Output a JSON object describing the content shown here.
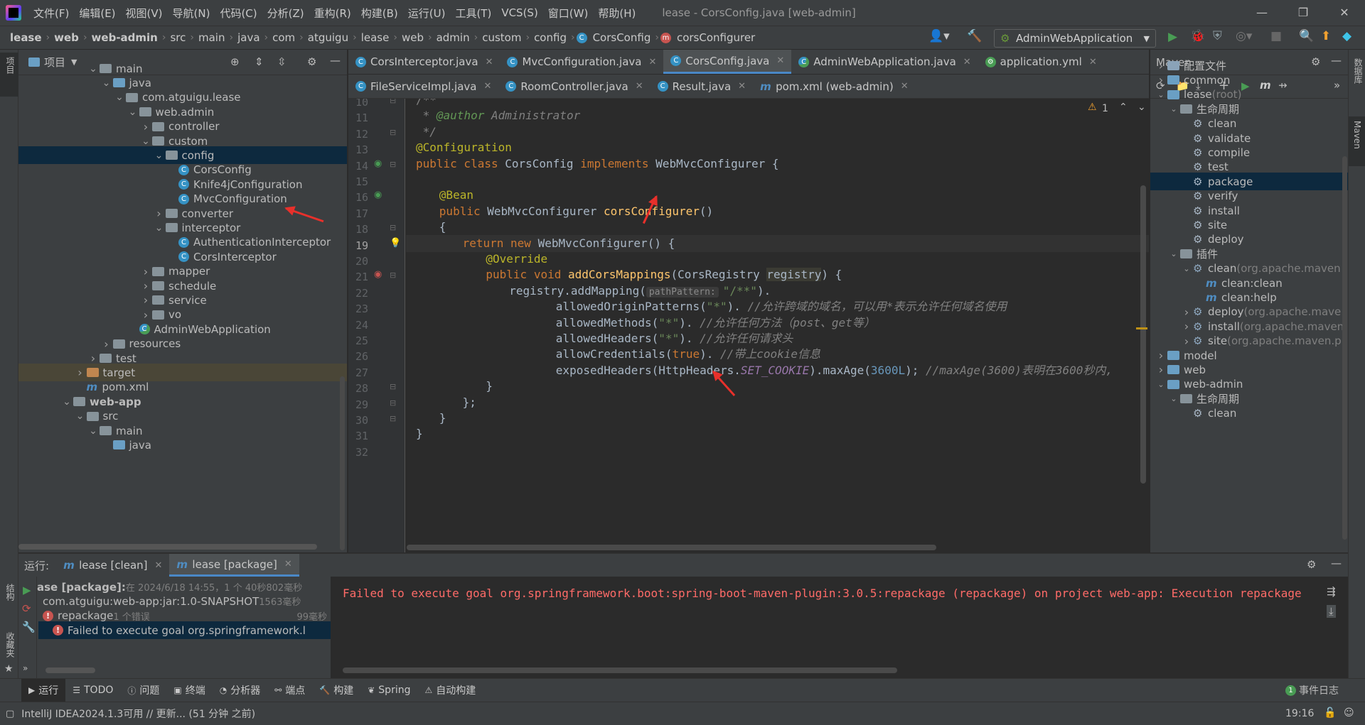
{
  "menubar": {
    "items": [
      "文件(F)",
      "编辑(E)",
      "视图(V)",
      "导航(N)",
      "代码(C)",
      "分析(Z)",
      "重构(R)",
      "构建(B)",
      "运行(U)",
      "工具(T)",
      "VCS(S)",
      "窗口(W)",
      "帮助(H)"
    ],
    "window_title": "lease - CorsConfig.java [web-admin]"
  },
  "breadcrumbs": [
    "lease",
    "web",
    "web-admin",
    "src",
    "main",
    "java",
    "com",
    "atguigu",
    "lease",
    "web",
    "admin",
    "custom",
    "config",
    "CorsConfig",
    "corsConfigurer"
  ],
  "run_config": "AdminWebApplication",
  "project_panel": {
    "title": "项目",
    "tree": [
      {
        "label": "main",
        "arrow": "v",
        "icon": "folder",
        "indent": 0
      },
      {
        "label": "java",
        "arrow": "v",
        "icon": "folder-blue",
        "indent": 1
      },
      {
        "label": "com.atguigu.lease",
        "arrow": "v",
        "icon": "folder",
        "indent": 2
      },
      {
        "label": "web.admin",
        "arrow": "v",
        "icon": "folder",
        "indent": 3
      },
      {
        "label": "controller",
        "arrow": ">",
        "icon": "folder",
        "indent": 4
      },
      {
        "label": "custom",
        "arrow": "v",
        "icon": "folder",
        "indent": 4
      },
      {
        "label": "config",
        "arrow": "v",
        "icon": "folder",
        "indent": 5,
        "selected": true
      },
      {
        "label": "CorsConfig",
        "arrow": "",
        "icon": "class",
        "indent": 6
      },
      {
        "label": "Knife4jConfiguration",
        "arrow": "",
        "icon": "class",
        "indent": 6
      },
      {
        "label": "MvcConfiguration",
        "arrow": "",
        "icon": "class",
        "indent": 6
      },
      {
        "label": "converter",
        "arrow": ">",
        "icon": "folder",
        "indent": 5
      },
      {
        "label": "interceptor",
        "arrow": "v",
        "icon": "folder",
        "indent": 5
      },
      {
        "label": "AuthenticationInterceptor",
        "arrow": "",
        "icon": "class",
        "indent": 6
      },
      {
        "label": "CorsInterceptor",
        "arrow": "",
        "icon": "class",
        "indent": 6
      },
      {
        "label": "mapper",
        "arrow": ">",
        "icon": "folder",
        "indent": 4
      },
      {
        "label": "schedule",
        "arrow": ">",
        "icon": "folder",
        "indent": 4
      },
      {
        "label": "service",
        "arrow": ">",
        "icon": "folder",
        "indent": 4
      },
      {
        "label": "vo",
        "arrow": ">",
        "icon": "folder",
        "indent": 4
      },
      {
        "label": "AdminWebApplication",
        "arrow": "",
        "icon": "springclass",
        "indent": 3
      },
      {
        "label": "resources",
        "arrow": ">",
        "icon": "folder",
        "indent": 1
      },
      {
        "label": "test",
        "arrow": ">",
        "icon": "folder",
        "indent": 0
      },
      {
        "label": "target",
        "arrow": ">",
        "icon": "folder-orange",
        "indent": -1,
        "excluded": true
      },
      {
        "label": "pom.xml",
        "arrow": "",
        "icon": "maven",
        "indent": -1
      },
      {
        "label": "web-app",
        "arrow": "v",
        "icon": "folder",
        "indent": -2,
        "bold": true
      },
      {
        "label": "src",
        "arrow": "v",
        "icon": "folder",
        "indent": -1
      },
      {
        "label": "main",
        "arrow": "v",
        "icon": "folder",
        "indent": 0
      },
      {
        "label": "java",
        "arrow": "",
        "icon": "folder-blue",
        "indent": 1
      }
    ]
  },
  "editor_tabs_row1": [
    {
      "label": "CorsInterceptor.java",
      "icon": "class"
    },
    {
      "label": "MvcConfiguration.java",
      "icon": "class"
    },
    {
      "label": "CorsConfig.java",
      "icon": "class",
      "active": true
    },
    {
      "label": "AdminWebApplication.java",
      "icon": "springclass"
    },
    {
      "label": "application.yml",
      "icon": "yml"
    }
  ],
  "editor_tabs_row2": [
    {
      "label": "FileServiceImpl.java",
      "icon": "class"
    },
    {
      "label": "RoomController.java",
      "icon": "class"
    },
    {
      "label": "Result.java",
      "icon": "class"
    },
    {
      "label": "pom.xml (web-admin)",
      "icon": "maven"
    }
  ],
  "editor": {
    "warning_count": "1",
    "line_numbers": [
      "10",
      "11",
      "12",
      "13",
      "14",
      "15",
      "16",
      "17",
      "18",
      "19",
      "20",
      "21",
      "22",
      "23",
      "24",
      "25",
      "26",
      "27",
      "28",
      "29",
      "30",
      "31",
      "32"
    ],
    "current_line": "19",
    "param_hint": "pathPattern:",
    "code": {
      "l10": "/**",
      "l11a": " * ",
      "l11b": "@author",
      "l11c": " Administrator",
      "l12": " */",
      "l13": "@Configuration",
      "l14a": "public class ",
      "l14b": "CorsConfig ",
      "l14c": "implements ",
      "l14d": "WebMvcConfigurer {",
      "l16": "@Bean",
      "l17a": "public ",
      "l17b": "WebMvcConfigurer ",
      "l17c": "corsConfigurer",
      "l17d": "()",
      "l18": "{",
      "l19a": "return ",
      "l19b": "new ",
      "l19c": "WebMvcConfigurer() {",
      "l20": "@Override",
      "l21a": "public void ",
      "l21b": "addCorsMappings",
      "l21c": "(CorsRegistry ",
      "l21d": "registry",
      "l21e": ") {",
      "l22a": "registry.addMapping(",
      "l22b": "\"/**\"",
      "l22c": ").",
      "l23a": "allowedOriginPatterns(",
      "l23b": "\"*\"",
      "l23c": "). ",
      "l23d": "//允许跨域的域名，可以用*表示允许任何域名使用",
      "l24a": "allowedMethods(",
      "l24b": "\"*\"",
      "l24c": "). ",
      "l24d": "//允许任何方法（post、get等）",
      "l25a": "allowedHeaders(",
      "l25b": "\"*\"",
      "l25c": "). ",
      "l25d": "//允许任何请求头",
      "l26a": "allowCredentials(",
      "l26b": "true",
      "l26c": "). ",
      "l26d": "//带上cookie信息",
      "l27a": "exposedHeaders(HttpHeaders.",
      "l27b": "SET_COOKIE",
      "l27c": ").maxAge(",
      "l27d": "3600L",
      "l27e": "); ",
      "l27f": "//maxAge(3600)表明在3600秒内,",
      "l28": "}",
      "l29": "};",
      "l30": "}",
      "l31": "}"
    }
  },
  "maven_panel": {
    "title": "Maven",
    "tree": [
      {
        "label": "配置文件",
        "arrow": ">",
        "icon": "profiles",
        "indent": 0
      },
      {
        "label": "common",
        "arrow": ">",
        "icon": "maven-module",
        "indent": 0
      },
      {
        "label": "lease",
        "suffix": " (root)",
        "arrow": "v",
        "icon": "maven-module",
        "indent": 0
      },
      {
        "label": "生命周期",
        "arrow": "v",
        "icon": "folder",
        "indent": 1
      },
      {
        "label": "clean",
        "icon": "gear",
        "indent": 2
      },
      {
        "label": "validate",
        "icon": "gear",
        "indent": 2
      },
      {
        "label": "compile",
        "icon": "gear",
        "indent": 2
      },
      {
        "label": "test",
        "icon": "gear",
        "indent": 2
      },
      {
        "label": "package",
        "icon": "gear",
        "indent": 2,
        "selected": true
      },
      {
        "label": "verify",
        "icon": "gear",
        "indent": 2
      },
      {
        "label": "install",
        "icon": "gear",
        "indent": 2
      },
      {
        "label": "site",
        "icon": "gear",
        "indent": 2
      },
      {
        "label": "deploy",
        "icon": "gear",
        "indent": 2
      },
      {
        "label": "插件",
        "arrow": "v",
        "icon": "folder",
        "indent": 1
      },
      {
        "label": "clean",
        "suffix": " (org.apache.maven",
        "arrow": "v",
        "icon": "plugin",
        "indent": 2
      },
      {
        "label": "clean:clean",
        "icon": "goal",
        "indent": 3
      },
      {
        "label": "clean:help",
        "icon": "goal",
        "indent": 3
      },
      {
        "label": "deploy",
        "suffix": " (org.apache.mave",
        "arrow": ">",
        "icon": "plugin",
        "indent": 2
      },
      {
        "label": "install",
        "suffix": " (org.apache.maven",
        "arrow": ">",
        "icon": "plugin",
        "indent": 2
      },
      {
        "label": "site",
        "suffix": " (org.apache.maven.p",
        "arrow": ">",
        "icon": "plugin",
        "indent": 2
      },
      {
        "label": "model",
        "arrow": ">",
        "icon": "maven-module",
        "indent": 0
      },
      {
        "label": "web",
        "arrow": ">",
        "icon": "maven-module",
        "indent": 0
      },
      {
        "label": "web-admin",
        "arrow": "v",
        "icon": "maven-module",
        "indent": 0
      },
      {
        "label": "生命周期",
        "arrow": "v",
        "icon": "folder",
        "indent": 1
      },
      {
        "label": "clean",
        "icon": "gear",
        "indent": 2
      }
    ]
  },
  "run_panel": {
    "label": "运行:",
    "tabs": [
      {
        "label": "lease [clean]"
      },
      {
        "label": "lease [package]",
        "active": true
      }
    ],
    "tree": [
      {
        "label": "ase [package]:",
        "detail": " 在 2024/6/18 14:55，1 个 40秒802毫秒",
        "icon": "none",
        "bold": true
      },
      {
        "label": "com.atguigu:web-app:jar:1.0-SNAPSHOT",
        "detail": "  1563毫秒",
        "icon": "none",
        "indent": 1
      },
      {
        "label": "repackage",
        "detail": "  1 个错误",
        "time": "99毫秒",
        "icon": "error",
        "indent": 1
      },
      {
        "label": "Failed to execute goal org.springframework.l",
        "icon": "error",
        "indent": 2,
        "selected": true
      }
    ],
    "console_text": "Failed to execute goal org.springframework.boot:spring-boot-maven-plugin:3.0.5:repackage (repackage) on project web-app: Execution repackage"
  },
  "bottom_tabs": [
    {
      "label": "运行",
      "icon": "play-icon",
      "active": true
    },
    {
      "label": "TODO",
      "icon": "list-icon"
    },
    {
      "label": "问题",
      "icon": "info-icon"
    },
    {
      "label": "终端",
      "icon": "terminal-icon"
    },
    {
      "label": "分析器",
      "icon": "profiler-icon"
    },
    {
      "label": "端点",
      "icon": "endpoints-icon"
    },
    {
      "label": "构建",
      "icon": "hammer-icon"
    },
    {
      "label": "Spring",
      "icon": "spring-icon"
    },
    {
      "label": "自动构建",
      "icon": "autobuild-icon"
    }
  ],
  "event_log": {
    "count": "1",
    "label": "事件日志"
  },
  "status": {
    "message": "IntelliJ IDEA2024.1.3可用 // 更新... (51 分钟 之前)",
    "time": "19:16"
  },
  "side_labels": {
    "project": "项目",
    "structure": "结构",
    "bookmarks": "收藏夹",
    "database": "数据库",
    "maven": "Maven"
  },
  "colors": {
    "accent": "#4a88c7",
    "error": "#c75450",
    "annotation_arrow": "#e8302b"
  }
}
